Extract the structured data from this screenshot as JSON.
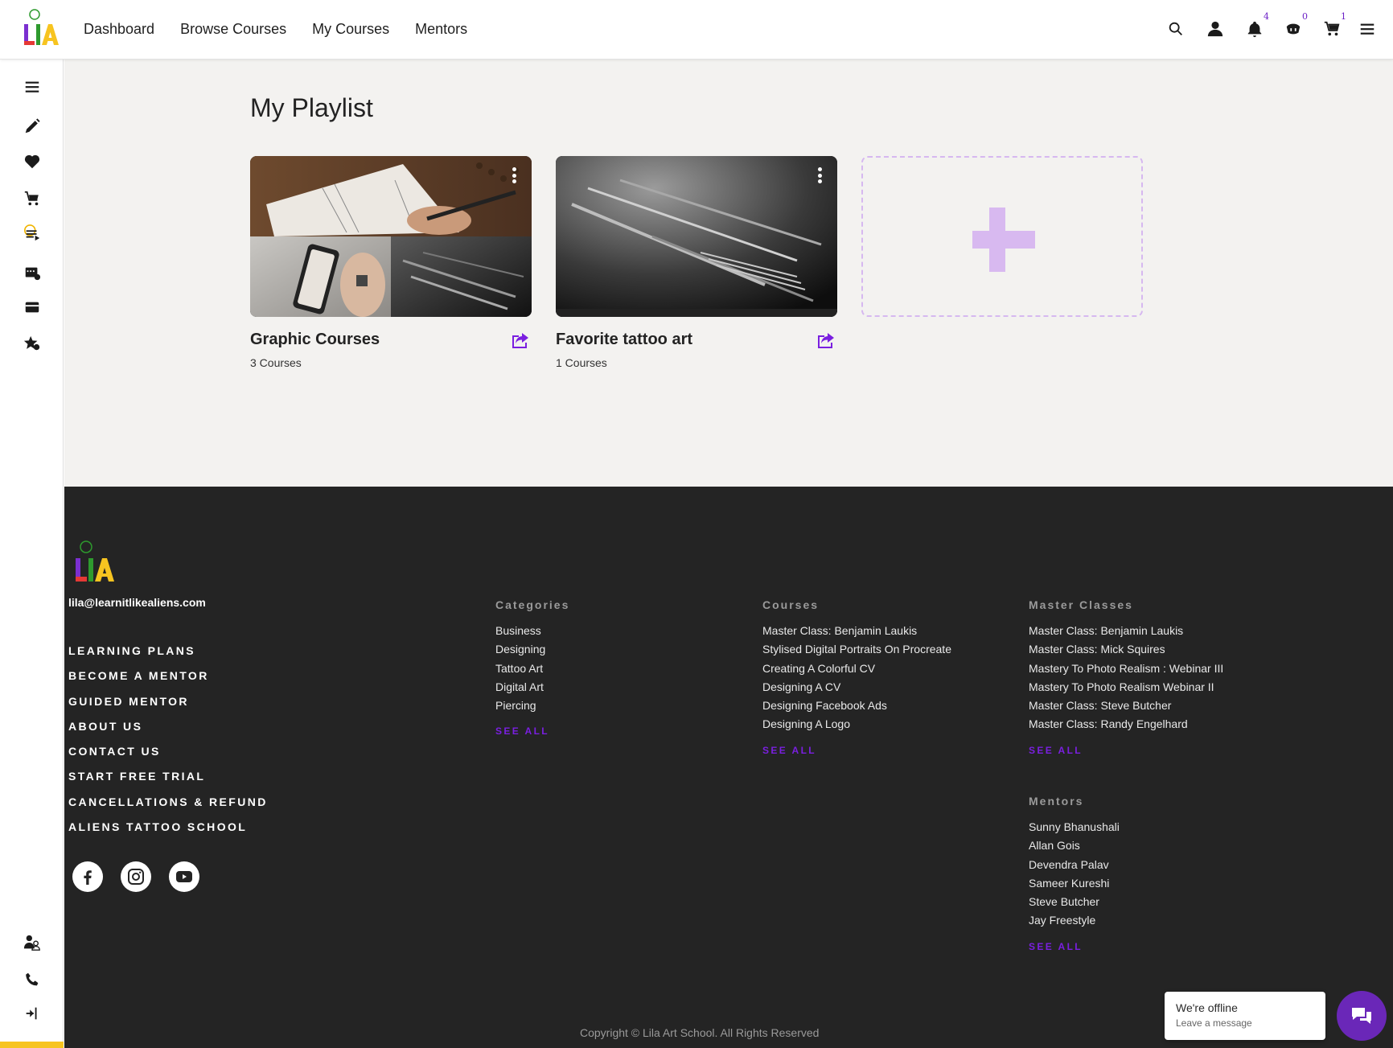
{
  "header": {
    "nav": [
      "Dashboard",
      "Browse Courses",
      "My Courses",
      "Mentors"
    ],
    "icons": [
      "search-icon",
      "user-icon",
      "bell-icon",
      "subscription-icon",
      "cart-icon",
      "menu-icon"
    ],
    "badges": {
      "notifications": "4",
      "subscriptions": "0",
      "cart": "1"
    }
  },
  "sidebar": {
    "icons": [
      "menu-icon",
      "pencil-icon",
      "heart-icon",
      "cart-icon",
      "playlist-icon",
      "calendar-icon",
      "card-icon",
      "star-icon",
      "mentor-icon",
      "phone-icon",
      "logout-icon"
    ]
  },
  "main": {
    "title": "My Playlist",
    "playlists": [
      {
        "title": "Graphic Courses",
        "count": "3 Courses"
      },
      {
        "title": "Favorite tattoo art",
        "count": "1 Courses"
      }
    ]
  },
  "footer": {
    "email": "lila@learnitlikealiens.com",
    "links": [
      "LEARNING PLANS",
      "BECOME A MENTOR",
      "GUIDED MENTOR",
      "ABOUT US",
      "CONTACT US",
      "START FREE TRIAL",
      "CANCELLATIONS & REFUND",
      "ALIENS TATTOO SCHOOL"
    ],
    "social": [
      "facebook-icon",
      "instagram-icon",
      "youtube-icon"
    ],
    "categories": {
      "heading": "Categories",
      "items": [
        "Business",
        "Designing",
        "Tattoo Art",
        "Digital Art",
        "Piercing"
      ],
      "see_all": "SEE ALL"
    },
    "courses": {
      "heading": "Courses",
      "items": [
        "Master Class: Benjamin Laukis",
        "Stylised Digital Portraits On Procreate",
        "Creating A Colorful CV",
        "Designing A CV",
        "Designing Facebook Ads",
        "Designing A Logo"
      ],
      "see_all": "SEE ALL"
    },
    "master_classes": {
      "heading": "Master Classes",
      "items": [
        "Master Class: Benjamin Laukis",
        "Master Class: Mick Squires",
        "Mastery To Photo Realism : Webinar III",
        "Mastery To Photo Realism Webinar II",
        "Master Class: Steve Butcher",
        "Master Class: Randy Engelhard"
      ],
      "see_all": "SEE ALL"
    },
    "mentors": {
      "heading": "Mentors",
      "items": [
        "Sunny Bhanushali",
        "Allan Gois",
        "Devendra Palav",
        "Sameer Kureshi",
        "Steve Butcher",
        "Jay Freestyle"
      ],
      "see_all": "SEE ALL"
    },
    "copyright": "Copyright © Lila Art School. All Rights Reserved"
  },
  "chat": {
    "title": "We're offline",
    "subtitle": "Leave a message"
  },
  "colors": {
    "accent": "#7a1fe0",
    "add_card_plus": "#d8b9f0",
    "footer_bg": "#242424",
    "sidebar_highlight": "#f7c420"
  }
}
